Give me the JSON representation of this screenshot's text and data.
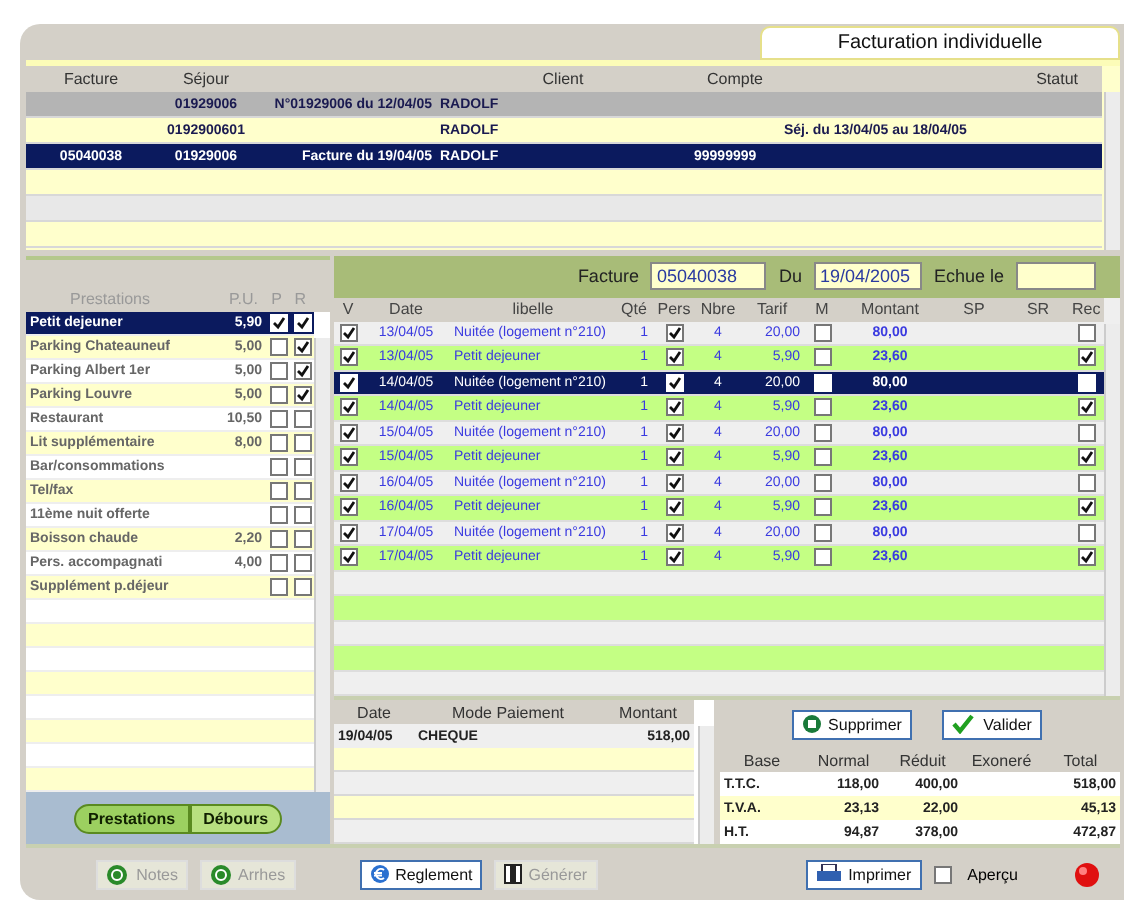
{
  "window": {
    "title": "Facturation individuelle"
  },
  "stays": {
    "columns": [
      "Facture",
      "Séjour",
      "Client",
      "Compte",
      "Statut"
    ],
    "rows": [
      {
        "kind": "group",
        "selected": false,
        "sejour": "01929006",
        "description": "N°01929006 du 12/04/05",
        "client": "RADOLF"
      },
      {
        "kind": "detail",
        "selected": false,
        "sejour": "0192900601",
        "client": "RADOLF",
        "info": "Séj. du 13/04/05 au 18/04/05"
      },
      {
        "kind": "detail",
        "selected": true,
        "facture": "05040038",
        "sejour": "01929006",
        "description": "Facture du 19/04/05",
        "client": "RADOLF",
        "compte": "99999999"
      }
    ]
  },
  "prestations": {
    "columns": [
      "Prestations",
      "P.U.",
      "P",
      "R"
    ],
    "items": [
      {
        "label": "Petit dejeuner",
        "price": "5,90",
        "p": true,
        "r": true,
        "selected": true
      },
      {
        "label": "Parking Chateauneuf",
        "price": "5,00",
        "p": false,
        "r": true,
        "selected": false
      },
      {
        "label": "Parking Albert 1er",
        "price": "5,00",
        "p": false,
        "r": true,
        "selected": false
      },
      {
        "label": "Parking Louvre",
        "price": "5,00",
        "p": false,
        "r": true,
        "selected": false
      },
      {
        "label": "Restaurant",
        "price": "10,50",
        "p": false,
        "r": false,
        "selected": false
      },
      {
        "label": "Lit supplémentaire",
        "price": "8,00",
        "p": false,
        "r": false,
        "selected": false
      },
      {
        "label": "Bar/consommations",
        "p": false,
        "r": false,
        "selected": false
      },
      {
        "label": "Tel/fax",
        "p": false,
        "r": false,
        "selected": false
      },
      {
        "label": "11ème nuit offerte",
        "p": false,
        "r": false,
        "selected": false
      },
      {
        "label": "Boisson chaude",
        "price": "2,20",
        "p": false,
        "r": false,
        "selected": false
      },
      {
        "label": "Pers. accompagnati",
        "price": "4,00",
        "p": false,
        "r": false,
        "selected": false
      },
      {
        "label": "Supplément p.déjeur",
        "p": false,
        "r": false,
        "selected": false
      }
    ],
    "tabs": [
      {
        "label": "Prestations",
        "selected": true
      },
      {
        "label": "Débours",
        "selected": false
      }
    ]
  },
  "invoice": {
    "facture_label": "Facture",
    "facture": "05040038",
    "du_label": "Du",
    "du": "19/04/2005",
    "echue_label": "Echue le"
  },
  "lines": {
    "columns": [
      "V",
      "Date",
      "libelle",
      "Qté",
      "Pers",
      "Nbre",
      "Tarif",
      "M",
      "Montant",
      "SP",
      "SR",
      "Rec"
    ],
    "rows": [
      {
        "kind": "room",
        "selected": false,
        "v": true,
        "date": "13/04/05",
        "libelle": "Nuitée (logement n°210)",
        "qte": "1",
        "pers": true,
        "nbre": "4",
        "tarif": "20,00",
        "m": false,
        "montant": "80,00",
        "rec": false
      },
      {
        "kind": "meal",
        "selected": false,
        "v": true,
        "date": "13/04/05",
        "libelle": "Petit dejeuner",
        "qte": "1",
        "pers": true,
        "nbre": "4",
        "tarif": "5,90",
        "m": false,
        "montant": "23,60",
        "rec": true
      },
      {
        "kind": "room",
        "selected": true,
        "v": true,
        "date": "14/04/05",
        "libelle": "Nuitée (logement n°210)",
        "qte": "1",
        "pers": true,
        "nbre": "4",
        "tarif": "20,00",
        "m": false,
        "montant": "80,00",
        "rec": false
      },
      {
        "kind": "meal",
        "selected": false,
        "v": true,
        "date": "14/04/05",
        "libelle": "Petit dejeuner",
        "qte": "1",
        "pers": true,
        "nbre": "4",
        "tarif": "5,90",
        "m": false,
        "montant": "23,60",
        "rec": true
      },
      {
        "kind": "room",
        "selected": false,
        "v": true,
        "date": "15/04/05",
        "libelle": "Nuitée (logement n°210)",
        "qte": "1",
        "pers": true,
        "nbre": "4",
        "tarif": "20,00",
        "m": false,
        "montant": "80,00",
        "rec": false
      },
      {
        "kind": "meal",
        "selected": false,
        "v": true,
        "date": "15/04/05",
        "libelle": "Petit dejeuner",
        "qte": "1",
        "pers": true,
        "nbre": "4",
        "tarif": "5,90",
        "m": false,
        "montant": "23,60",
        "rec": true
      },
      {
        "kind": "room",
        "selected": false,
        "v": true,
        "date": "16/04/05",
        "libelle": "Nuitée (logement n°210)",
        "qte": "1",
        "pers": true,
        "nbre": "4",
        "tarif": "20,00",
        "m": false,
        "montant": "80,00",
        "rec": false
      },
      {
        "kind": "meal",
        "selected": false,
        "v": true,
        "date": "16/04/05",
        "libelle": "Petit dejeuner",
        "qte": "1",
        "pers": true,
        "nbre": "4",
        "tarif": "5,90",
        "m": false,
        "montant": "23,60",
        "rec": true
      },
      {
        "kind": "room",
        "selected": false,
        "v": true,
        "date": "17/04/05",
        "libelle": "Nuitée (logement n°210)",
        "qte": "1",
        "pers": true,
        "nbre": "4",
        "tarif": "20,00",
        "m": false,
        "montant": "80,00",
        "rec": false
      },
      {
        "kind": "meal",
        "selected": false,
        "v": true,
        "date": "17/04/05",
        "libelle": "Petit dejeuner",
        "qte": "1",
        "pers": true,
        "nbre": "4",
        "tarif": "5,90",
        "m": false,
        "montant": "23,60",
        "rec": true
      }
    ]
  },
  "payments": {
    "columns": [
      "Date",
      "Mode Paiement",
      "Montant"
    ],
    "rows": [
      {
        "date": "19/04/05",
        "mode": "CHEQUE",
        "montant": "518,00"
      }
    ]
  },
  "actions": [
    {
      "kind": "delete",
      "label": "Supprimer"
    },
    {
      "kind": "validate",
      "label": "Valider"
    }
  ],
  "totals": {
    "columns": [
      "Base",
      "Normal",
      "Réduit",
      "Exoneré",
      "Total"
    ],
    "rows": [
      {
        "base": "T.T.C.",
        "normal": "118,00",
        "reduit": "400,00",
        "total": "518,00"
      },
      {
        "base": "T.V.A.",
        "normal": "23,13",
        "reduit": "22,00",
        "total": "45,13"
      },
      {
        "base": "H.T.",
        "normal": "94,87",
        "reduit": "378,00",
        "total": "472,87"
      }
    ]
  },
  "toolbar": [
    {
      "kind": "notes",
      "label": "Notes",
      "disabled": true
    },
    {
      "kind": "notes",
      "label": "Arrhes",
      "disabled": true
    },
    {
      "kind": "payment",
      "label": "Reglement",
      "disabled": false
    },
    {
      "kind": "generate",
      "label": "Générer",
      "disabled": true
    },
    {
      "kind": "print",
      "label": "Imprimer",
      "disabled": false
    }
  ],
  "preview": {
    "label": "Aperçu",
    "checked": false
  }
}
